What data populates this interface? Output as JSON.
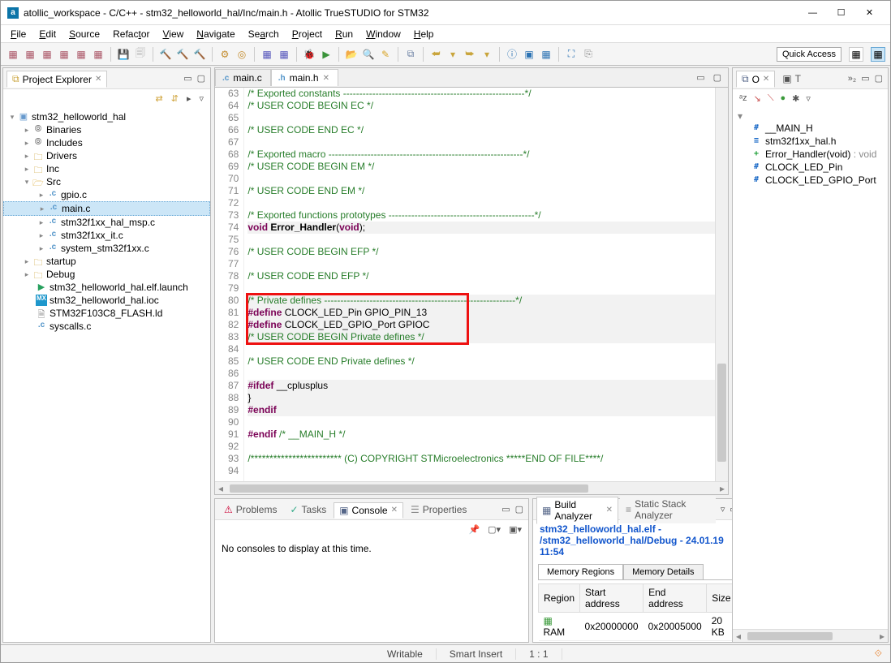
{
  "window": {
    "title": "atollic_workspace - C/C++ - stm32_helloworld_hal/Inc/main.h - Atollic TrueSTUDIO for STM32"
  },
  "menu": [
    "File",
    "Edit",
    "Source",
    "Refactor",
    "View",
    "Navigate",
    "Search",
    "Project",
    "Run",
    "Window",
    "Help"
  ],
  "quick_access": "Quick Access",
  "project_explorer": {
    "title": "Project Explorer",
    "project": "stm32_helloworld_hal",
    "folders": {
      "binaries": "Binaries",
      "includes": "Includes",
      "drivers": "Drivers",
      "inc": "Inc",
      "src": "Src",
      "startup": "startup",
      "debug": "Debug"
    },
    "src_files": [
      "gpio.c",
      "main.c",
      "stm32f1xx_hal_msp.c",
      "stm32f1xx_it.c",
      "system_stm32f1xx.c"
    ],
    "root_files": {
      "launch": "stm32_helloworld_hal.elf.launch",
      "ioc": "stm32_helloworld_hal.ioc",
      "ld": "STM32F103C8_FLASH.ld",
      "syscalls": "syscalls.c"
    }
  },
  "editor": {
    "tabs": [
      {
        "label": "main.c",
        "active": false
      },
      {
        "label": "main.h",
        "active": true
      }
    ],
    "first_line": 63,
    "lines": [
      {
        "n": 63,
        "html": "<span class='c-comment'>/* Exported constants --------------------------------------------------------*/</span>"
      },
      {
        "n": 64,
        "html": "<span class='c-comment'>/* USER CODE BEGIN EC */</span>"
      },
      {
        "n": 65,
        "html": ""
      },
      {
        "n": 66,
        "html": "<span class='c-comment'>/* USER CODE END EC */</span>"
      },
      {
        "n": 67,
        "html": ""
      },
      {
        "n": 68,
        "html": "<span class='c-comment'>/* Exported macro ------------------------------------------------------------*/</span>"
      },
      {
        "n": 69,
        "html": "<span class='c-comment'>/* USER CODE BEGIN EM */</span>"
      },
      {
        "n": 70,
        "html": ""
      },
      {
        "n": 71,
        "html": "<span class='c-comment'>/* USER CODE END EM */</span>"
      },
      {
        "n": 72,
        "html": ""
      },
      {
        "n": 73,
        "html": "<span class='c-comment'>/* Exported functions prototypes ---------------------------------------------*/</span>"
      },
      {
        "n": 74,
        "html": "<span class='c-keyword'>void</span> <span class='c-id' style='font-weight:bold'>Error_Handler</span>(<span class='c-keyword'>void</span>);",
        "de": true
      },
      {
        "n": 75,
        "html": ""
      },
      {
        "n": 76,
        "html": "<span class='c-comment'>/* USER CODE BEGIN EFP */</span>"
      },
      {
        "n": 77,
        "html": ""
      },
      {
        "n": 78,
        "html": "<span class='c-comment'>/* USER CODE END EFP */</span>"
      },
      {
        "n": 79,
        "html": ""
      },
      {
        "n": 80,
        "html": "<span class='c-comment'>/* Private defines -----------------------------------------------------------*/</span>",
        "de": true
      },
      {
        "n": 81,
        "html": "<span class='c-pp'>#define</span> CLOCK_LED_Pin GPIO_PIN_13",
        "de": true
      },
      {
        "n": 82,
        "html": "<span class='c-pp'>#define</span> CLOCK_LED_GPIO_Port GPIOC",
        "de": true
      },
      {
        "n": 83,
        "html": "<span class='c-comment'>/* USER CODE BEGIN Private defines */</span>",
        "de": true
      },
      {
        "n": 84,
        "html": ""
      },
      {
        "n": 85,
        "html": "<span class='c-comment'>/* USER CODE END Private defines */</span>"
      },
      {
        "n": 86,
        "html": ""
      },
      {
        "n": 87,
        "html": "<span class='c-pp'>#ifdef</span> __cplusplus",
        "de": true
      },
      {
        "n": 88,
        "html": "}",
        "de": true
      },
      {
        "n": 89,
        "html": "<span class='c-pp'>#endif</span>",
        "de": true
      },
      {
        "n": 90,
        "html": ""
      },
      {
        "n": 91,
        "html": "<span class='c-pp'>#endif</span> <span class='c-comment'>/* __MAIN_H */</span>"
      },
      {
        "n": 92,
        "html": ""
      },
      {
        "n": 93,
        "html": "<span class='c-comment'>/************************ (C) COPYRIGHT STMicroelectronics *****END OF FILE****/</span>"
      },
      {
        "n": 94,
        "html": ""
      }
    ]
  },
  "outline": {
    "items": [
      {
        "icon": "#",
        "cls": "out-d",
        "label": "__MAIN_H"
      },
      {
        "icon": "≡",
        "cls": "out-d",
        "label": "stm32f1xx_hal.h"
      },
      {
        "icon": "+",
        "cls": "out-m",
        "label": "Error_Handler(void)",
        "suffix": " : void"
      },
      {
        "icon": "#",
        "cls": "out-d",
        "label": "CLOCK_LED_Pin"
      },
      {
        "icon": "#",
        "cls": "out-d",
        "label": "CLOCK_LED_GPIO_Port"
      }
    ]
  },
  "console": {
    "tabs": [
      "Problems",
      "Tasks",
      "Console",
      "Properties"
    ],
    "active": 2,
    "body": "No consoles to display at this time."
  },
  "build_analyzer": {
    "tabs": [
      "Build Analyzer",
      "Static Stack Analyzer"
    ],
    "link": "stm32_helloworld_hal.elf - /stm32_helloworld_hal/Debug - 24.01.19 11:54",
    "sub_tabs": [
      "Memory Regions",
      "Memory Details"
    ],
    "cols": [
      "Region",
      "Start address",
      "End address",
      "Size"
    ],
    "rows": [
      {
        "region": "RAM",
        "start": "0x20000000",
        "end": "0x20005000",
        "size": "20 KB"
      }
    ]
  },
  "status": {
    "writable": "Writable",
    "insert": "Smart Insert",
    "pos": "1 : 1"
  }
}
